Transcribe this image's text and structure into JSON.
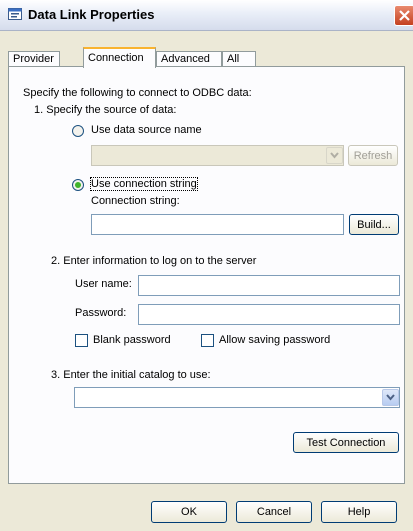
{
  "window": {
    "title": "Data Link Properties",
    "title_icon": "database-link-icon",
    "close_icon": "close-icon"
  },
  "tabs": [
    {
      "label": "Provider"
    },
    {
      "label": "Connection"
    },
    {
      "label": "Advanced"
    },
    {
      "label": "All"
    }
  ],
  "connection": {
    "intro": "Specify the following to connect to ODBC data:",
    "step1": "1. Specify the source of data:",
    "use_dsn": {
      "label": "Use data source name",
      "selected": false
    },
    "dsn_value": "",
    "refresh_button": "Refresh",
    "use_conn_string": {
      "label": "Use connection string",
      "selected": true
    },
    "conn_string_label": "Connection string:",
    "conn_string_value": "",
    "build_button": "Build...",
    "step2": "2. Enter information to log on to the server",
    "user_name_label": "User name:",
    "user_name_value": "",
    "password_label": "Password:",
    "password_value": "",
    "blank_password": {
      "label": "Blank password",
      "checked": false
    },
    "allow_saving": {
      "label": "Allow saving password",
      "checked": false
    },
    "step3": "3. Enter the initial catalog to use:",
    "catalog_value": "",
    "test_button": "Test Connection"
  },
  "footer": {
    "ok": "OK",
    "cancel": "Cancel",
    "help": "Help"
  }
}
